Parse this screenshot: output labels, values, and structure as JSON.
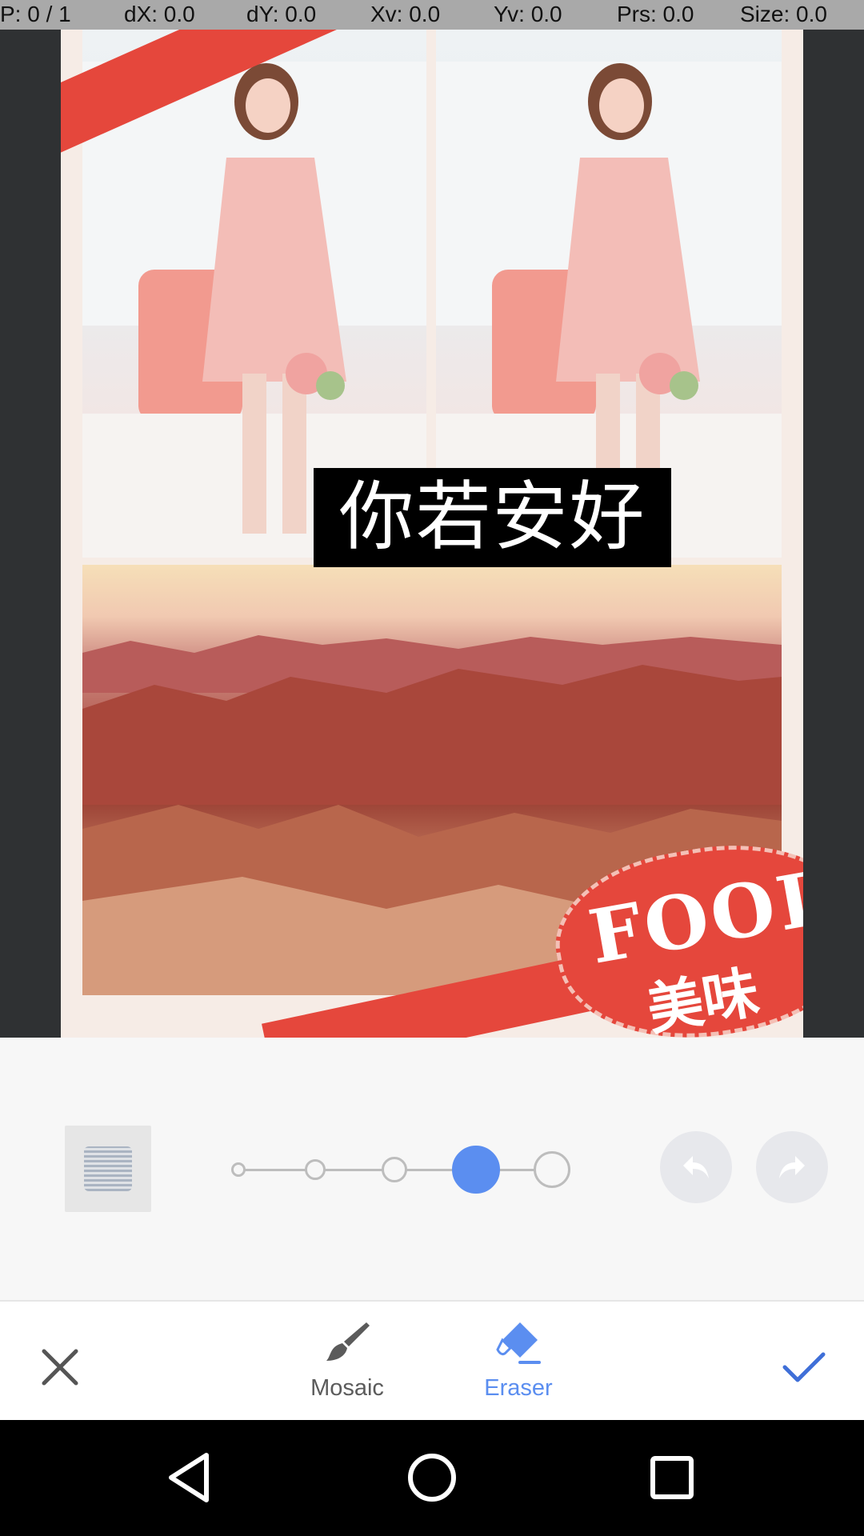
{
  "pointer_info": {
    "p": "P: 0 / 1",
    "dx": "dX: 0.0",
    "dy": "dY: 0.0",
    "xv": "Xv: 0.0",
    "yv": "Yv: 0.0",
    "prs": "Prs: 0.0",
    "size": "Size: 0.0"
  },
  "photo": {
    "caption": "你若安好",
    "badge_word": "FOOD",
    "badge_sub": "美味"
  },
  "brush_sizes": {
    "count": 5,
    "selected_index": 3
  },
  "controls": {
    "undo_icon": "undo-icon",
    "redo_icon": "redo-icon"
  },
  "toolbar": {
    "mosaic_label": "Mosaic",
    "eraser_label": "Eraser",
    "active_tool": "Eraser"
  },
  "colors": {
    "accent": "#5b8ef0",
    "inactive": "#5b5b5b",
    "canvas_bg": "#2f3133"
  }
}
